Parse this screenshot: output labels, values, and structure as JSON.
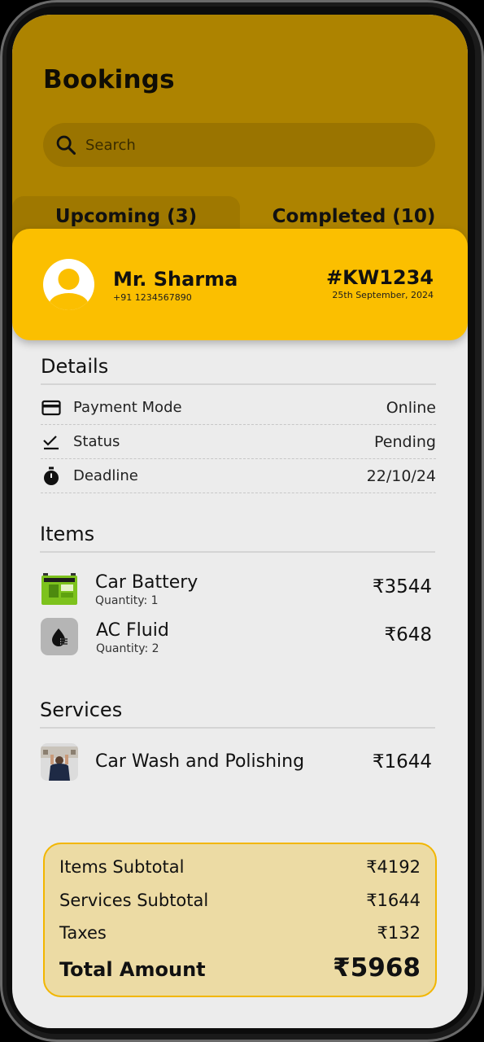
{
  "header": {
    "title": "Bookings",
    "search_placeholder": "Search",
    "tabs": [
      {
        "label": "Upcoming (3)"
      },
      {
        "label": "Completed (10)"
      }
    ]
  },
  "booking": {
    "customer_name": "Mr. Sharma",
    "customer_phone": "+91 1234567890",
    "booking_id": "#KW1234",
    "date": "25th September, 2024"
  },
  "details": {
    "title": "Details",
    "rows": [
      {
        "icon": "credit-card-icon",
        "label": "Payment Mode",
        "value": "Online"
      },
      {
        "icon": "checkmark-icon",
        "label": "Status",
        "value": "Pending"
      },
      {
        "icon": "stopwatch-icon",
        "label": "Deadline",
        "value": "22/10/24"
      }
    ]
  },
  "items": {
    "title": "Items",
    "list": [
      {
        "name": "Car Battery",
        "quantity": "Quantity: 1",
        "price": "₹3544",
        "thumb": "battery-image"
      },
      {
        "name": "AC Fluid",
        "quantity": "Quantity: 2",
        "price": "₹648",
        "thumb": "fluid-icon"
      }
    ]
  },
  "services": {
    "title": "Services",
    "list": [
      {
        "name": "Car Wash and Polishing",
        "price": "₹1644",
        "thumb": "car-wash-image"
      }
    ]
  },
  "summary": {
    "items_subtotal_label": "Items Subtotal",
    "items_subtotal": "₹4192",
    "services_subtotal_label": "Services Subtotal",
    "services_subtotal": "₹1644",
    "taxes_label": "Taxes",
    "taxes": "₹132",
    "total_label": "Total Amount",
    "total": "₹5968"
  },
  "colors": {
    "accent": "#fbbf00",
    "header_dim": "#ad8300",
    "summary_bg": "#ecdba4"
  }
}
